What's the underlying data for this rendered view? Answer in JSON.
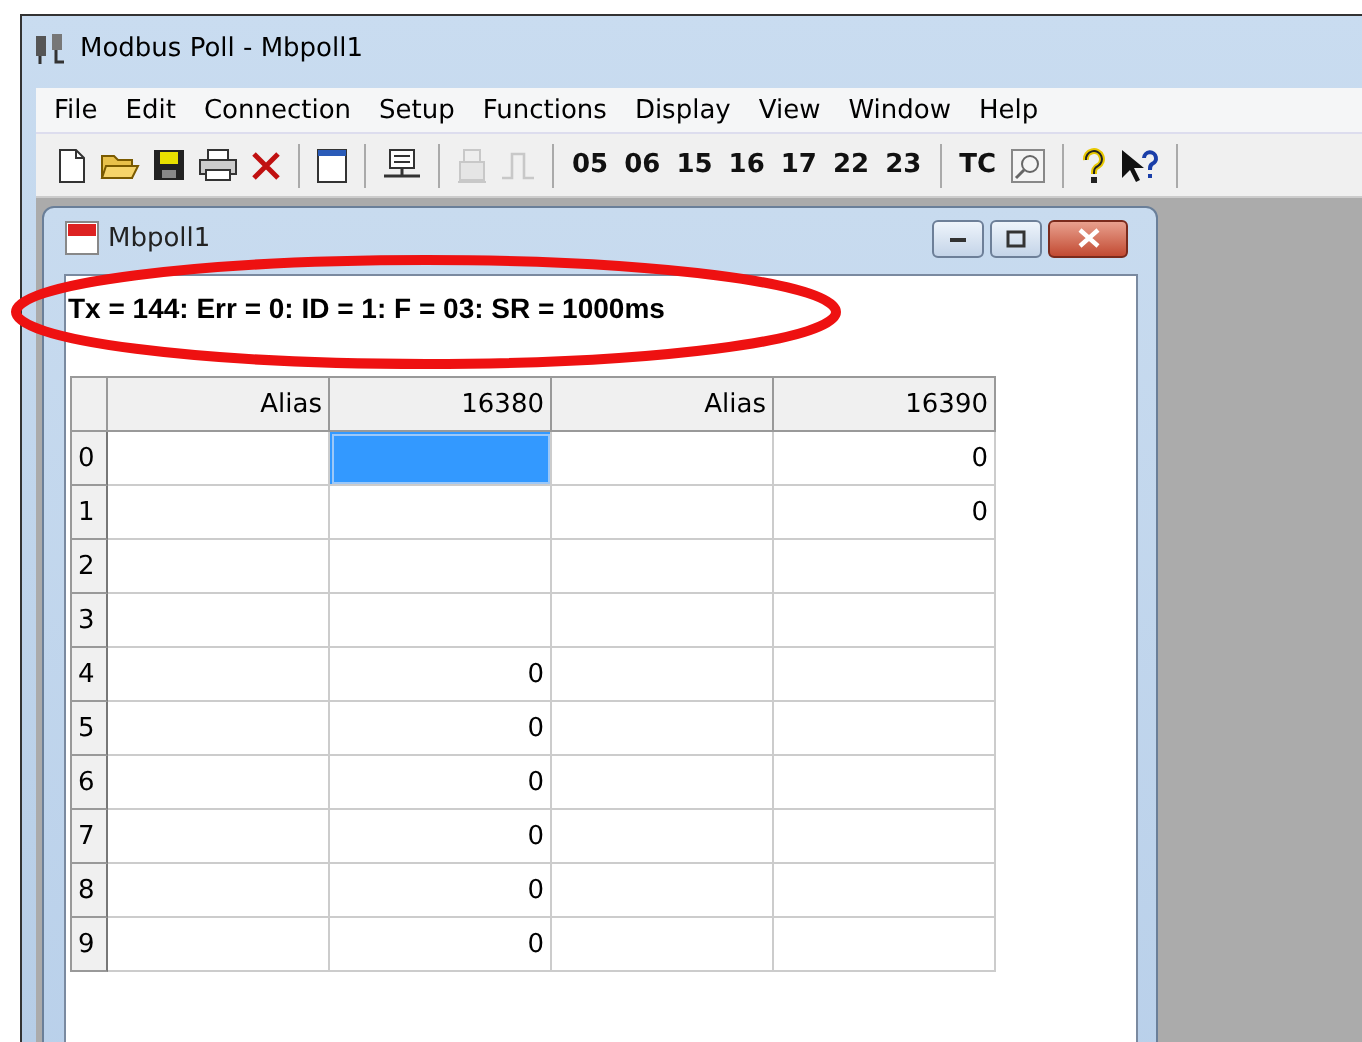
{
  "window": {
    "title": "Modbus Poll - Mbpoll1"
  },
  "menu": [
    "File",
    "Edit",
    "Connection",
    "Setup",
    "Functions",
    "Display",
    "View",
    "Window",
    "Help"
  ],
  "toolbar": {
    "icons": [
      {
        "disabled": false
      },
      {
        "disabled": false
      },
      {
        "disabled": false
      },
      {
        "disabled": false
      },
      {
        "disabled": false
      },
      {
        "disabled": false
      },
      {
        "disabled": false
      },
      {
        "disabled": true
      },
      {
        "disabled": true
      }
    ],
    "function_codes": [
      "05",
      "06",
      "15",
      "16",
      "17",
      "22",
      "23"
    ],
    "tc": "TC",
    "tail_icons": [
      {
        "disabled": false
      },
      {
        "disabled": false
      },
      {
        "disabled": false
      }
    ]
  },
  "child_window": {
    "title": "Mbpoll1",
    "status": "Tx = 144: Err = 0: ID = 1: F = 03: SR = 1000ms"
  },
  "table": {
    "columns": [
      "Alias",
      "16380",
      "Alias",
      "16390"
    ],
    "rows": [
      {
        "label": "0",
        "cells": [
          {
            "selected": false
          },
          {
            "selected": true
          },
          {
            "selected": false
          },
          {
            "value": "0",
            "selected": false
          }
        ]
      },
      {
        "label": "1",
        "cells": [
          {
            "selected": false
          },
          {
            "selected": false
          },
          {
            "selected": false
          },
          {
            "value": "0",
            "selected": false
          }
        ]
      },
      {
        "label": "2",
        "cells": [
          {
            "selected": false
          },
          {
            "selected": false
          },
          {
            "selected": false
          },
          {
            "selected": false
          }
        ]
      },
      {
        "label": "3",
        "cells": [
          {
            "selected": false
          },
          {
            "selected": false
          },
          {
            "selected": false
          },
          {
            "selected": false
          }
        ]
      },
      {
        "label": "4",
        "cells": [
          {
            "selected": false
          },
          {
            "value": "0",
            "selected": false
          },
          {
            "selected": false
          },
          {
            "selected": false
          }
        ]
      },
      {
        "label": "5",
        "cells": [
          {
            "selected": false
          },
          {
            "value": "0",
            "selected": false
          },
          {
            "selected": false
          },
          {
            "selected": false
          }
        ]
      },
      {
        "label": "6",
        "cells": [
          {
            "selected": false
          },
          {
            "value": "0",
            "selected": false
          },
          {
            "selected": false
          },
          {
            "selected": false
          }
        ]
      },
      {
        "label": "7",
        "cells": [
          {
            "selected": false
          },
          {
            "value": "0",
            "selected": false
          },
          {
            "selected": false
          },
          {
            "selected": false
          }
        ]
      },
      {
        "label": "8",
        "cells": [
          {
            "selected": false
          },
          {
            "value": "0",
            "selected": false
          },
          {
            "selected": false
          },
          {
            "selected": false
          }
        ]
      },
      {
        "label": "9",
        "cells": [
          {
            "selected": false
          },
          {
            "value": "0",
            "selected": false
          },
          {
            "selected": false
          },
          {
            "selected": false
          }
        ]
      }
    ]
  },
  "annotation": {
    "kind": "ellipse"
  }
}
